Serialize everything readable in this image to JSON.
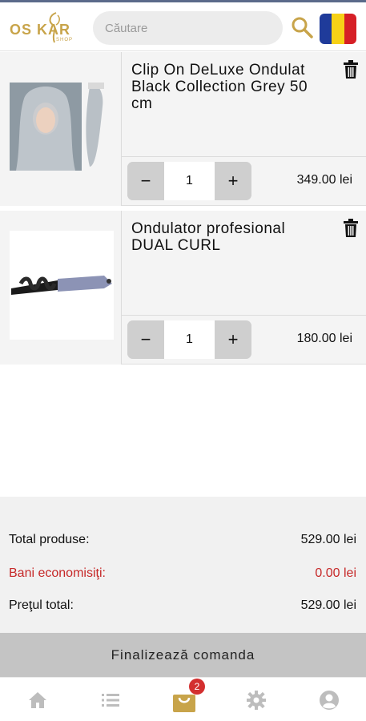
{
  "header": {
    "logo_text": "OS KAR",
    "logo_sub": "SHOP",
    "search_placeholder": "Căutare",
    "flag_colors": [
      "#1f3b9a",
      "#f7d117",
      "#d61f26"
    ],
    "accent_color": "#c8a44a"
  },
  "cart": {
    "items": [
      {
        "title": "Clip On DeLuxe Ondulat Black Collection Grey 50 cm",
        "quantity": "1",
        "price": "349.00 lei",
        "minus_label": "−",
        "plus_label": "+"
      },
      {
        "title": "Ondulator profesional DUAL CURL",
        "quantity": "1",
        "price": "180.00 lei",
        "minus_label": "−",
        "plus_label": "+"
      }
    ]
  },
  "totals": {
    "products_label": "Total produse:",
    "products_value": "529.00 lei",
    "savings_label": "Bani economisiţi:",
    "savings_value": "0.00 lei",
    "total_label": "Preţul total:",
    "total_value": "529.00 lei",
    "savings_color": "#c62828"
  },
  "finalize_label": "Finalizează comanda",
  "bottom_nav": {
    "items": [
      "home-icon",
      "list-icon",
      "shopping-bag-icon",
      "gear-icon",
      "user-icon"
    ],
    "cart_badge": "2",
    "active_color": "#c8a44a",
    "inactive_color": "#bdbdbd"
  }
}
